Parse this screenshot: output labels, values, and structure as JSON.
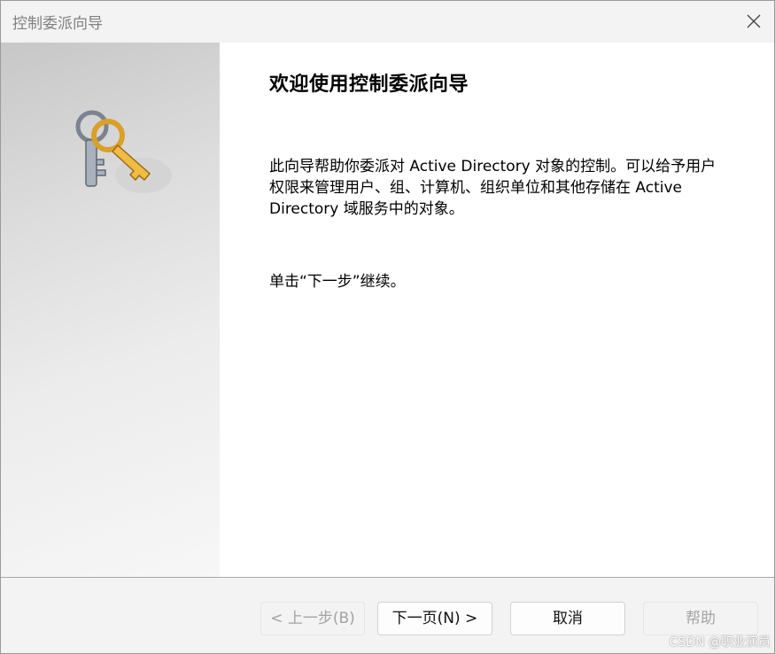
{
  "window": {
    "title": "控制委派向导",
    "close_icon": "close-icon"
  },
  "side_panel": {
    "icon": "keys-icon"
  },
  "content": {
    "heading": "欢迎使用控制委派向导",
    "description": "此向导帮助你委派对 Active Directory 对象的控制。可以给予用户权限来管理用户、组、计算机、组织单位和其他存储在 Active Directory 域服务中的对象。",
    "instruction": "单击“下一步”继续。"
  },
  "buttons": {
    "back": "< 上一步(B)",
    "next": "下一页(N) >",
    "cancel": "取消",
    "help": "帮助"
  },
  "watermark": "CSDN @职业演员",
  "colors": {
    "disabled_text": "#a3a3a3",
    "keys_gold": "#e8b43c",
    "keys_silver": "#9aa4b0"
  }
}
